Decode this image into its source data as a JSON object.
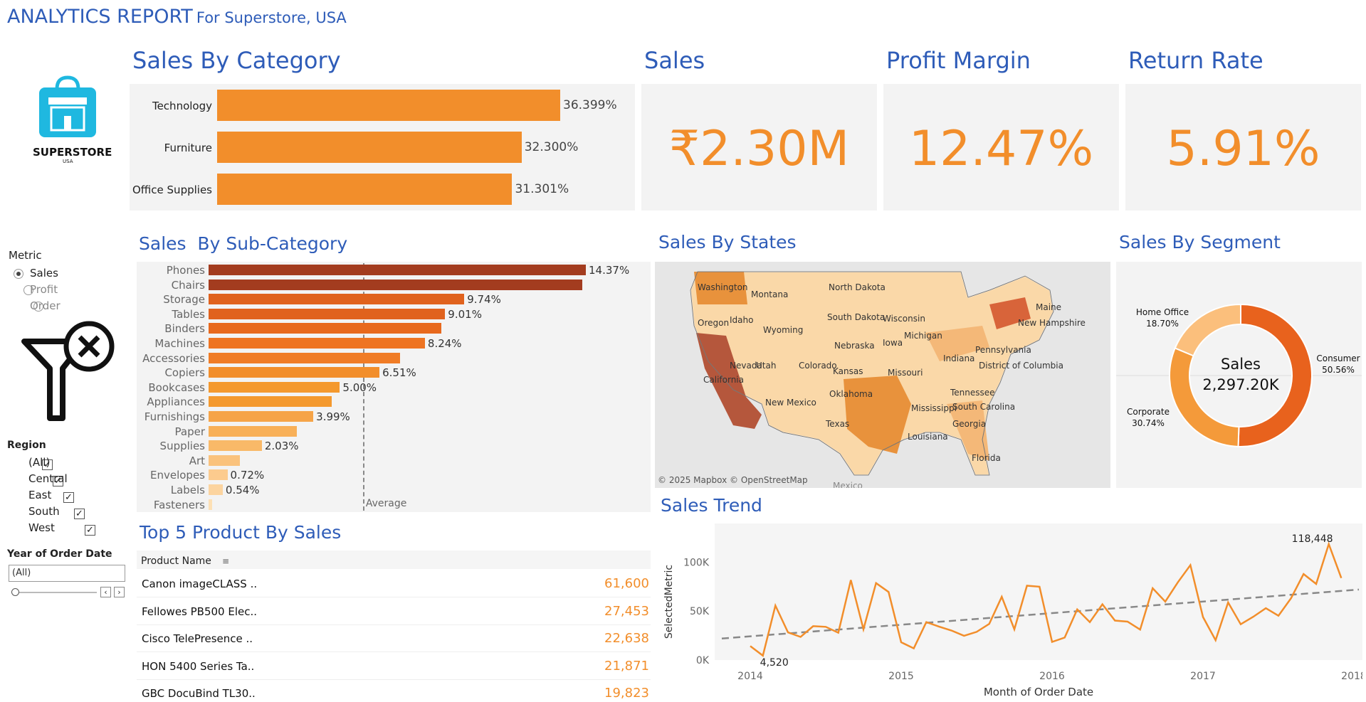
{
  "header": {
    "title": "ANALYTICS REPORT",
    "subtitle": "For Superstore, USA"
  },
  "logo": {
    "brand": "SUPERSTORE",
    "sub": "USA"
  },
  "sections": {
    "category": "Sales By Category",
    "sales": "Sales",
    "profit_margin": "Profit Margin",
    "return_rate": "Return Rate",
    "sub_category": "Sales  By Sub-Category",
    "states": "Sales By States",
    "segment": "Sales By Segment",
    "trend": "Sales Trend",
    "top5": "Top 5 Product By Sales"
  },
  "kpis": {
    "sales": "₹2.30M",
    "profit_margin": "12.47%",
    "return_rate": "5.91%"
  },
  "category_chart": {
    "type": "bar",
    "categories": [
      "Technology",
      "Furniture",
      "Office Supplies"
    ],
    "values": [
      36.399,
      32.3,
      31.301
    ],
    "labels": [
      "36.399%",
      "32.300%",
      "31.301%"
    ]
  },
  "sub_category_chart": {
    "type": "bar",
    "categories": [
      "Phones",
      "Chairs",
      "Storage",
      "Tables",
      "Binders",
      "Machines",
      "Accessories",
      "Copiers",
      "Bookcases",
      "Appliances",
      "Furnishings",
      "Paper",
      "Supplies",
      "Art",
      "Envelopes",
      "Labels",
      "Fasteners"
    ],
    "values": [
      14.37,
      14.23,
      9.74,
      9.01,
      8.87,
      8.24,
      7.28,
      6.51,
      5.0,
      4.69,
      3.99,
      3.36,
      2.03,
      1.18,
      0.72,
      0.54,
      0.13
    ],
    "labels": [
      "14.37%",
      "",
      "9.74%",
      "9.01%",
      "",
      "8.24%",
      "",
      "6.51%",
      "5.00%",
      "",
      "3.99%",
      "",
      "2.03%",
      "",
      "0.72%",
      "0.54%",
      ""
    ],
    "colors": [
      "#a33c1f",
      "#a33c1f",
      "#e0621d",
      "#e0621d",
      "#e8691d",
      "#ee7422",
      "#f07c26",
      "#f28e2b",
      "#f4992e",
      "#f4992e",
      "#f6a448",
      "#f8b058",
      "#f9b968",
      "#fac27c",
      "#fccb8e",
      "#fcd49f",
      "#fde0b5"
    ],
    "average_label": "Average",
    "average_value": 5.88
  },
  "sidebar": {
    "metric_title": "Metric",
    "metric_options": [
      "Sales",
      "Profit",
      "Order"
    ],
    "region_title": "Region",
    "regions": [
      "(All)",
      "Central",
      "East",
      "South",
      "West"
    ],
    "year_title": "Year of Order Date",
    "year_value": "(All)"
  },
  "map": {
    "credit": "© 2025 Mapbox © OpenStreetMap",
    "mexico": "Mexico",
    "states": [
      "Washington",
      "Montana",
      "North Dakota",
      "Oregon",
      "Idaho",
      "Wyoming",
      "South Dakota",
      "Wisconsin",
      "Michigan",
      "Maine",
      "New Hampshire",
      "Nebraska",
      "Iowa",
      "Pennsylvania",
      "Nevada",
      "Utah",
      "Colorado",
      "Kansas",
      "Missouri",
      "Indiana",
      "California",
      "District of Columbia",
      "Oklahoma",
      "Tennessee",
      "New Mexico",
      "Mississippi",
      "South Carolina",
      "Texas",
      "Louisiana",
      "Georgia",
      "Florida"
    ]
  },
  "segment_chart": {
    "type": "pie",
    "center_title": "Sales",
    "center_value": "2,297.20K",
    "slices": [
      {
        "name": "Consumer",
        "value": 50.56,
        "label": "50.56%",
        "color": "#e8621d"
      },
      {
        "name": "Corporate",
        "value": 30.74,
        "label": "30.74%",
        "color": "#f49a3a"
      },
      {
        "name": "Home Office",
        "value": 18.7,
        "label": "18.70%",
        "color": "#fbbf7c"
      }
    ]
  },
  "top5": {
    "header": "Product Name",
    "rows": [
      {
        "name": "Canon imageCLASS ..",
        "value": "61,600"
      },
      {
        "name": "Fellowes PB500 Elec..",
        "value": "27,453"
      },
      {
        "name": "Cisco TelePresence ..",
        "value": "22,638"
      },
      {
        "name": "HON 5400 Series Ta..",
        "value": "21,871"
      },
      {
        "name": "GBC DocuBind TL30..",
        "value": "19,823"
      }
    ]
  },
  "trend_chart": {
    "type": "line",
    "ylabel": "SelectedMetric",
    "xlabel": "Month of Order Date",
    "yticks": [
      "0K",
      "50K",
      "100K"
    ],
    "xticks": [
      "2014",
      "2015",
      "2016",
      "2017",
      "2018"
    ],
    "ylim": [
      0,
      125000
    ],
    "values": [
      14237,
      4520,
      55691,
      28295,
      23648,
      34595,
      33946,
      27909,
      81777,
      31453,
      78629,
      69546,
      18174,
      11951,
      38726,
      34195,
      30132,
      24797,
      28765,
      36898,
      64595,
      31405,
      75973,
      74920,
      18542,
      22979,
      51716,
      38750,
      56988,
      40344,
      39262,
      31115,
      73410,
      59687,
      79412,
      96999,
      43971,
      20301,
      58872,
      36522,
      44261,
      52981,
      45264,
      63121,
      87867,
      77777,
      118448,
      83829
    ],
    "min_label": "4,520",
    "max_label": "118,448",
    "trend": [
      22000,
      72000
    ]
  }
}
